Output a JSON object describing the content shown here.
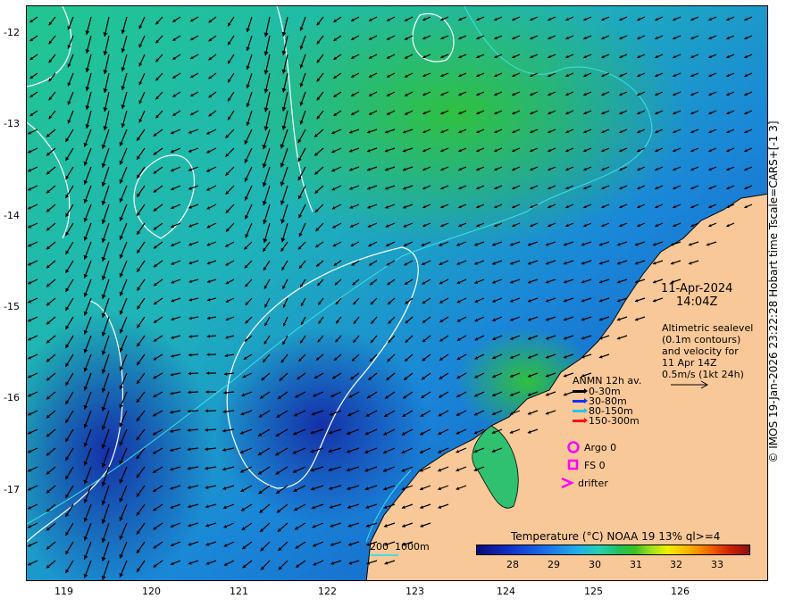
{
  "map": {
    "lat_labels": [
      "-12",
      "-13",
      "-14",
      "-15",
      "-16",
      "-17"
    ],
    "lon_labels": [
      "119",
      "120",
      "121",
      "122",
      "123",
      "124",
      "125",
      "126"
    ],
    "colors": {
      "land": "#f9c898",
      "contour": "#ffffff",
      "isobath": "#40e0e0"
    }
  },
  "annotations": {
    "date": "11-Apr-2024",
    "time": "14:04Z",
    "altimetry": [
      "Altimetric sealevel",
      "(0.1m contours)",
      "and velocity for",
      "11 Apr 14Z",
      "0.5m/s (1kt 24h)"
    ],
    "anmn_title": "ANMN 12h av.",
    "anmn_legend": [
      {
        "label": "0-30m",
        "color": "#000000"
      },
      {
        "label": "30-80m",
        "color": "#1030ff"
      },
      {
        "label": "80-150m",
        "color": "#20c8e8"
      },
      {
        "label": "150-300m",
        "color": "#ff1010"
      }
    ],
    "argo": "Argo 0",
    "fs": "FS 0",
    "drifter": "drifter",
    "symbol_color": "#ff00ff",
    "scale_bar": "200  1000m"
  },
  "colorbar": {
    "title": "Temperature (°C) NOAA 19 13% ql>=4",
    "ticks": [
      "28",
      "29",
      "30",
      "31",
      "32",
      "33"
    ]
  },
  "credit": "© IMOS 19-Jan-2026 23:22:28 Hobart time Tscale=CARS+[-1 3]"
}
